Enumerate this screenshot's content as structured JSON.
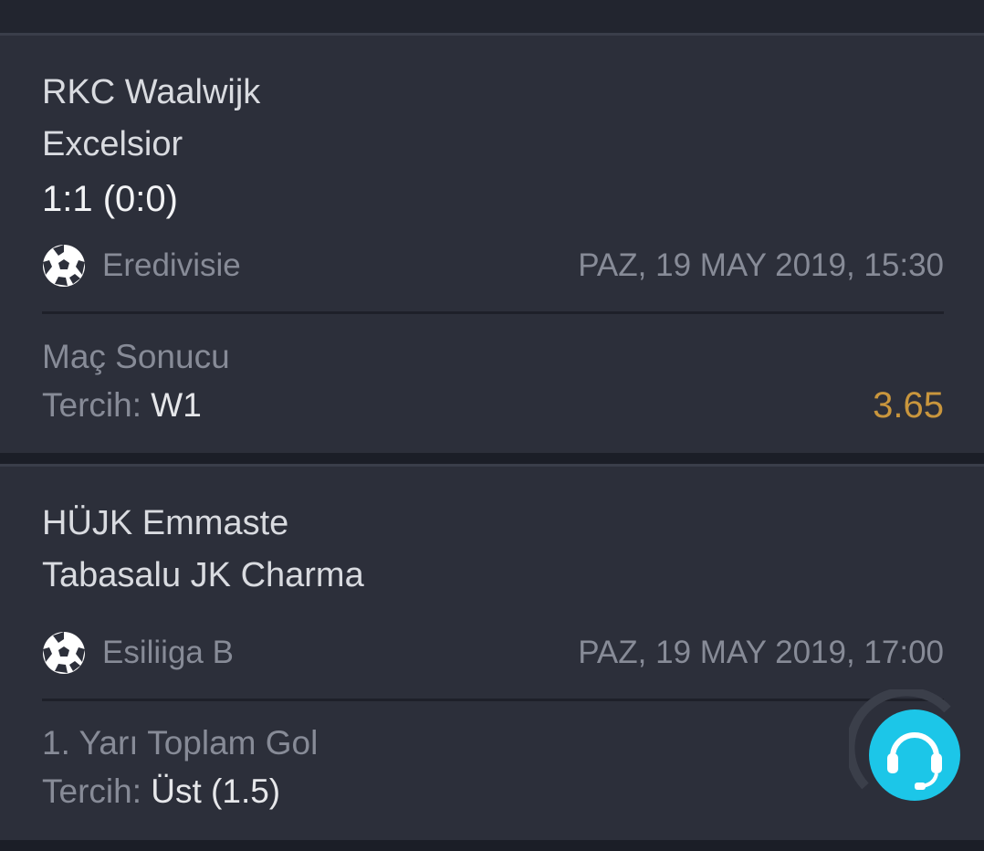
{
  "colors": {
    "background": "#1b1e27",
    "card": "#2c2f3a",
    "muted_text": "#878b97",
    "odds": "#c9963d",
    "support_button": "#1cc6e8"
  },
  "bets": [
    {
      "home_team": "RKC Waalwijk",
      "away_team": "Excelsior",
      "score": "1:1 (0:0)",
      "sport_icon": "soccer-ball-icon",
      "league": "Eredivisie",
      "datetime": "PAZ, 19 MAY 2019, 15:30",
      "market": "Maç Sonucu",
      "choice_label": "Tercih:",
      "choice_value": "W1",
      "odds": "3.65"
    },
    {
      "home_team": "HÜJK Emmaste",
      "away_team": "Tabasalu JK Charma",
      "score": "",
      "sport_icon": "soccer-ball-icon",
      "league": "Esiliiga B",
      "datetime": "PAZ, 19 MAY 2019, 17:00",
      "market": "1. Yarı Toplam Gol",
      "choice_label": "Tercih:",
      "choice_value": "Üst (1.5)",
      "odds": ""
    }
  ],
  "support": {
    "icon": "headset-icon"
  }
}
